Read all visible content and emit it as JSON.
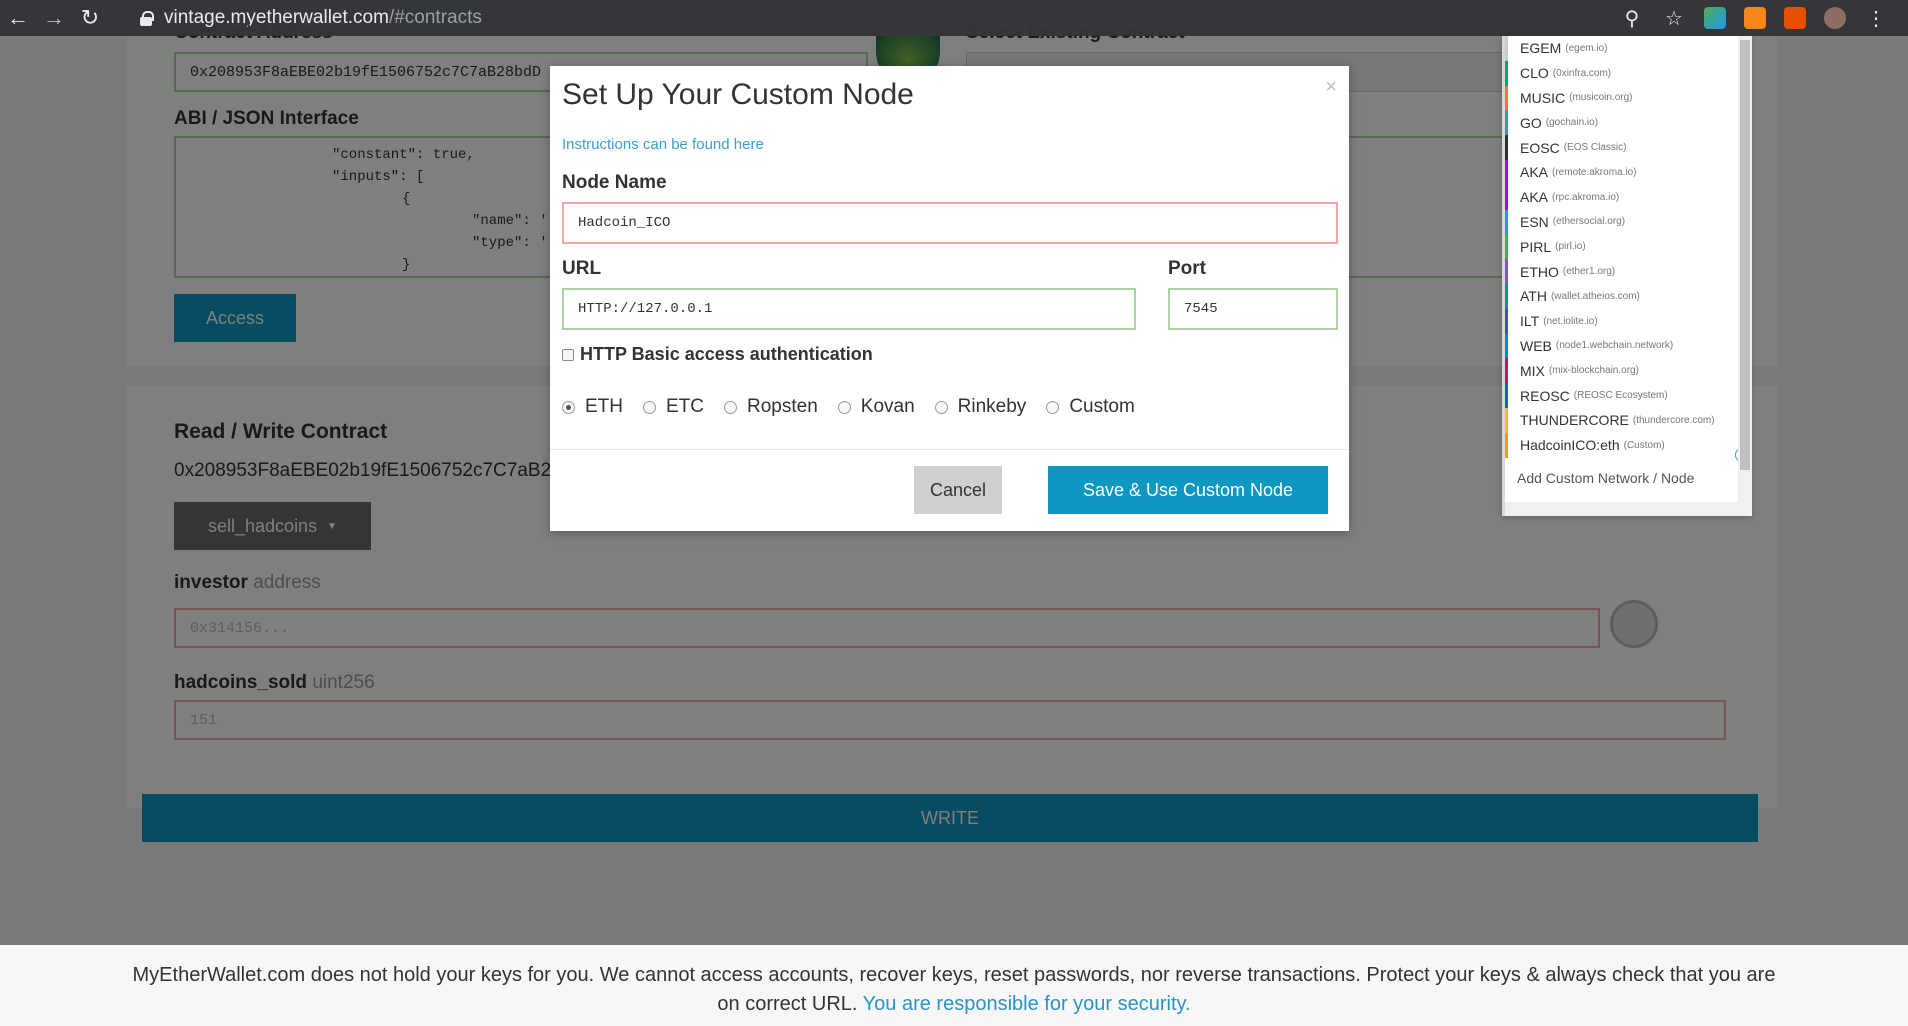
{
  "browser": {
    "url_host": "vintage.myetherwallet.com",
    "url_path": "/#contracts"
  },
  "page": {
    "contract_address_label": "Contract Address",
    "contract_address_value": "0x208953F8aEBE02b19fE1506752c7C7aB28bdD",
    "select_contract_label": "Select Existing Contract",
    "abi_label": "ABI / JSON Interface",
    "abi_lines": [
      "\"constant\": true,",
      "\"inputs\": [",
      "{",
      "\"name\": '",
      "\"type\": '",
      "}"
    ],
    "access_button": "Access",
    "rw_title": "Read / Write Contract",
    "rw_address": "0x208953F8aEBE02b19fE1506752c7C7aB2",
    "function_select": "sell_hadcoins",
    "investor_label": "investor",
    "investor_hint": "address",
    "investor_placeholder": "0x314156...",
    "hadcoins_label": "hadcoins_sold",
    "hadcoins_hint": "uint256",
    "hadcoins_placeholder": "151",
    "write_button": "WRITE"
  },
  "modal": {
    "title": "Set Up Your Custom Node",
    "close": "×",
    "instructions": "Instructions can be found here",
    "node_name_label": "Node Name",
    "node_name_value": "Hadcoin_ICO",
    "url_label": "URL",
    "url_value": "HTTP://127.0.0.1",
    "port_label": "Port",
    "port_value": "7545",
    "auth_label": "HTTP Basic access authentication",
    "radios": [
      {
        "label": "ETH",
        "selected": true
      },
      {
        "label": "ETC",
        "selected": false
      },
      {
        "label": "Ropsten",
        "selected": false
      },
      {
        "label": "Kovan",
        "selected": false
      },
      {
        "label": "Rinkeby",
        "selected": false
      },
      {
        "label": "Custom",
        "selected": false
      }
    ],
    "cancel_button": "Cancel",
    "save_button": "Save & Use Custom Node"
  },
  "networks": [
    {
      "name": "EGEM",
      "sub": "(egem.io)",
      "color": "#ccc"
    },
    {
      "name": "CLO",
      "sub": "(0xinfra.com)",
      "color": "#00a86b"
    },
    {
      "name": "MUSIC",
      "sub": "(musicoin.org)",
      "color": "#ff7043"
    },
    {
      "name": "GO",
      "sub": "(gochain.io)",
      "color": "#26a69a"
    },
    {
      "name": "EOSC",
      "sub": "(EOS Classic)",
      "color": "#333333"
    },
    {
      "name": "AKA",
      "sub": "(remote.akroma.io)",
      "color": "#aa00ff"
    },
    {
      "name": "AKA",
      "sub": "(rpc.akroma.io)",
      "color": "#aa00ff"
    },
    {
      "name": "ESN",
      "sub": "(ethersocial.org)",
      "color": "#2196f3"
    },
    {
      "name": "PIRL",
      "sub": "(pirl.io)",
      "color": "#4caf50"
    },
    {
      "name": "ETHO",
      "sub": "(ether1.org)",
      "color": "#7e57c2"
    },
    {
      "name": "ATH",
      "sub": "(wallet.atheios.com)",
      "color": "#009688"
    },
    {
      "name": "ILT",
      "sub": "(net.iolite.io)",
      "color": "#3f51b5"
    },
    {
      "name": "WEB",
      "sub": "(node1.webchain.network)",
      "color": "#0288d1"
    },
    {
      "name": "MIX",
      "sub": "(mix-blockchain.org)",
      "color": "#c2185b"
    },
    {
      "name": "REOSC",
      "sub": "(REOSC Ecosystem)",
      "color": "#1565c0"
    },
    {
      "name": "THUNDERCORE",
      "sub": "(thundercore.com)",
      "color": "#ffc107"
    },
    {
      "name": "HadcoinICO:eth",
      "sub": "(Custom)",
      "color": "#ff9800"
    }
  ],
  "add_network": "Add Custom Network / Node",
  "footer": {
    "text": "MyEtherWallet.com does not hold your keys for you. We cannot access accounts, recover keys, reset passwords, nor reverse transactions. Protect your keys & always check that you are on correct URL.",
    "link": "You are responsible for your security."
  }
}
